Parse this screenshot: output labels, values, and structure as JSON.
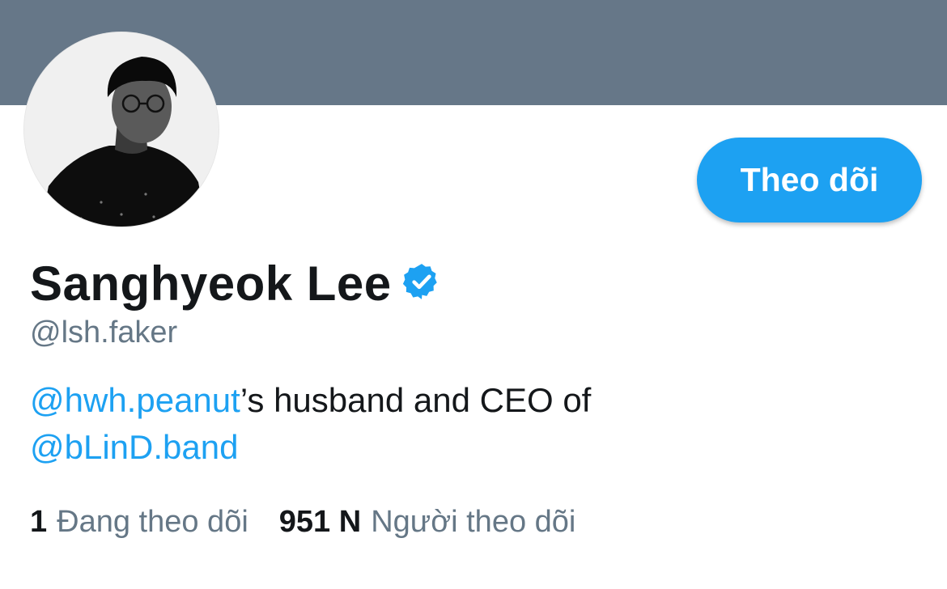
{
  "profile": {
    "banner_color": "#667788",
    "avatar_desc": "profile-photo",
    "display_name": "Sanghyeok Lee",
    "verified_icon": "verified-badge-icon",
    "handle": "@lsh.faker",
    "follow_label": "Theo dõi",
    "bio": {
      "mention1": "@hwh.peanut",
      "text1": "’s husband and CEO of",
      "mention2": "@bLinD.band"
    },
    "stats": {
      "following_count": "1",
      "following_label": "Đang theo dõi",
      "followers_count": "951 N",
      "followers_label": "Người theo dõi"
    }
  },
  "colors": {
    "accent": "#1da1f2",
    "secondary_text": "#657786",
    "primary_text": "#14171a"
  }
}
